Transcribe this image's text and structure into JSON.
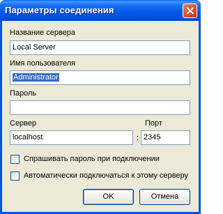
{
  "window": {
    "title": "Параметры соединения"
  },
  "server_name": {
    "label": "Название сервера",
    "value": "Local Server"
  },
  "username": {
    "label": "Имя пользователя",
    "value": "Administrator"
  },
  "password": {
    "label": "Пароль",
    "value": ""
  },
  "server": {
    "label": "Сервер",
    "value": "localhost"
  },
  "port": {
    "label": "Порт",
    "value": "2345"
  },
  "separator": ":",
  "options": {
    "ask_password": {
      "label": "Спрашивать пароль при подключении",
      "checked": false
    },
    "auto_connect": {
      "label": "Автоматически подключаться к этому серверу",
      "checked": false
    }
  },
  "buttons": {
    "ok": "OK",
    "cancel": "Отмена"
  }
}
